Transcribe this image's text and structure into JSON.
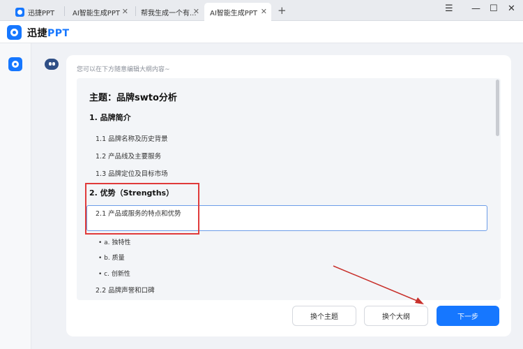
{
  "tabs": [
    {
      "label": "迅捷PPT",
      "has_logo": true
    },
    {
      "label": "AI智能生成PPT"
    },
    {
      "label": "帮我生成一个有..."
    },
    {
      "label": "AI智能生成PPT",
      "active": true
    }
  ],
  "window_controls": {
    "menu": "☰",
    "minimize": "—",
    "maximize": "☐",
    "close": "✕"
  },
  "tab_close_glyph": "✕",
  "new_tab_glyph": "+",
  "brand": {
    "name_prefix": "迅捷",
    "name_suffix": "PPT"
  },
  "hint": "您可以在下方随意编辑大纲内容~",
  "outline": {
    "title": "主题：品牌swto分析",
    "sections": [
      {
        "heading": "1. 品牌简介",
        "items": [
          "1.1  品牌名称及历史背景",
          "1.2  产品线及主要服务",
          "1.3  品牌定位及目标市场"
        ]
      },
      {
        "heading": "2. 优势（Strengths）",
        "items": [
          "2.1  产品或服务的特点和优势"
        ]
      }
    ],
    "bullets": [
      "• a. 独特性",
      "• b. 质量",
      "• c. 创新性"
    ],
    "after_bullets": "2.2  品牌声誉和口碑"
  },
  "buttons": {
    "change_theme": "换个主题",
    "change_outline": "换个大纲",
    "next": "下一步"
  },
  "colors": {
    "accent": "#1677ff",
    "annotation": "#e03a3a"
  }
}
